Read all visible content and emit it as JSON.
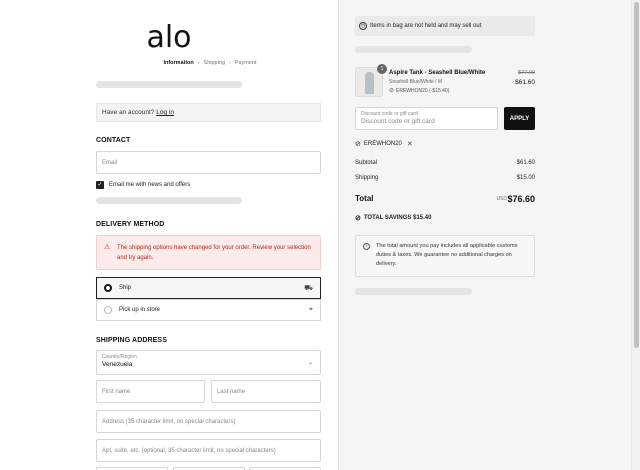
{
  "brand": {
    "logo_text": "alo"
  },
  "breadcrumbs": [
    {
      "label": "Information",
      "active": true
    },
    {
      "label": "Shipping",
      "active": false
    },
    {
      "label": "Payment",
      "active": false
    }
  ],
  "account": {
    "prompt": "Have an account?",
    "login_label": "Log in"
  },
  "contact": {
    "title": "CONTACT",
    "email_placeholder": "Email",
    "newsletter_label": "Email me with news and offers",
    "newsletter_checked": true
  },
  "delivery": {
    "title": "DELIVERY METHOD",
    "alert": "The shipping options have changed for your order. Review your selection and try again.",
    "options": [
      {
        "label": "Ship",
        "selected": true,
        "icon": "truck-icon"
      },
      {
        "label": "Pick up in store",
        "selected": false,
        "icon": "location-pin-icon"
      }
    ]
  },
  "shipping_address": {
    "title": "SHIPPING ADDRESS",
    "country_label": "Country/Region",
    "country_value": "Venezuela",
    "first_name_placeholder": "First name",
    "last_name_placeholder": "Last name",
    "address_placeholder": "Address (35 character limit, no special characters)",
    "apt_placeholder": "Apt, suite, etc. (optional, 35 character limit, no special characters)"
  },
  "summary": {
    "notice": "Items in bag are not held and may sell out",
    "product": {
      "name": "Aspire Tank - Seashell Blue/White",
      "variant": "Seashell Blue/White / M",
      "discount": "EREWHON20 (-$15.40)",
      "original_price": "$77.00",
      "price": "$61.60",
      "quantity": "1"
    },
    "discount_field": {
      "label": "Discount code or gift card",
      "placeholder": "Discount code or gift card"
    },
    "apply_label": "APPLY",
    "applied_code": "EREWHON20",
    "subtotal_label": "Subtotal",
    "subtotal_value": "$61.60",
    "shipping_label": "Shipping",
    "shipping_value": "$15.00",
    "total_label": "Total",
    "currency": "USD",
    "total_value": "$76.60",
    "savings_label": "TOTAL SAVINGS",
    "savings_value": "$15.40",
    "info_text": "The total amount you pay includes all applicable customs duties & taxes. We guarantee no additional charges on delivery."
  }
}
